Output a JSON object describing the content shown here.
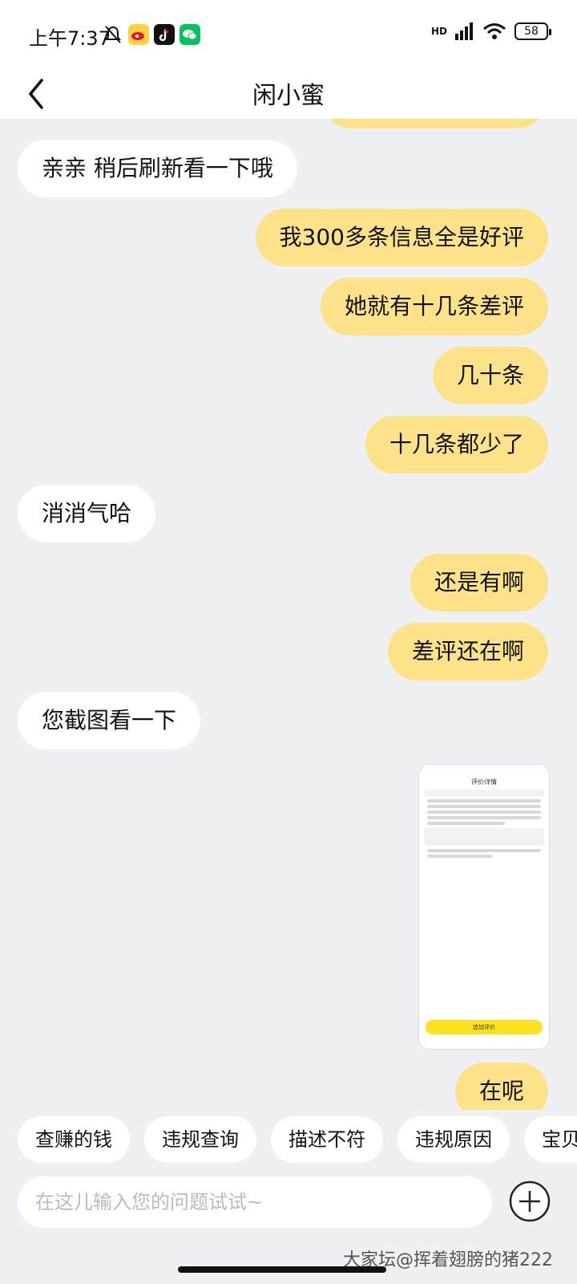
{
  "status": {
    "time": "上午7:37",
    "icons": [
      "mute-bell-icon",
      "weibo-icon",
      "tiktok-icon",
      "wechat-icon"
    ],
    "network": "HD",
    "battery": "58"
  },
  "header": {
    "title": "闲小蜜",
    "back_icon": "chevron-left-icon"
  },
  "messages": [
    {
      "from": "them",
      "text": "亲亲 稍后刷新看一下哦"
    },
    {
      "from": "me",
      "text": "我300多条信息全是好评"
    },
    {
      "from": "me",
      "text": "她就有十几条差评"
    },
    {
      "from": "me",
      "text": "几十条"
    },
    {
      "from": "me",
      "text": "十几条都少了"
    },
    {
      "from": "them",
      "text": "消消气哈"
    },
    {
      "from": "me",
      "text": "还是有啊"
    },
    {
      "from": "me",
      "text": "差评还在啊"
    },
    {
      "from": "them",
      "text": "您截图看一下"
    },
    {
      "from": "me",
      "type": "image",
      "caption": "评价详情",
      "button": "追加评价"
    },
    {
      "from": "me",
      "text": "在呢"
    }
  ],
  "quick_chips": [
    "查赚的钱",
    "违规查询",
    "描述不符",
    "违规原因",
    "宝贝"
  ],
  "input": {
    "placeholder": "在这儿输入您的问题试试~",
    "plus_icon": "plus-circle-icon"
  },
  "watermark": "大家坛@挥着翅膀的猪222",
  "colors": {
    "my_bubble": "#fde28a",
    "their_bubble": "#ffffff",
    "background": "#eff0f4"
  }
}
